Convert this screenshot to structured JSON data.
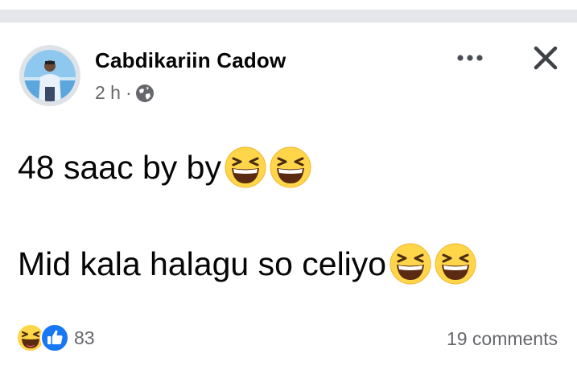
{
  "post": {
    "author_name": "Cabdikariin Cadow",
    "timestamp": "2 h",
    "separator": "·",
    "privacy_icon": "globe-icon",
    "more_icon": "more-options-icon",
    "close_icon": "close-icon",
    "lines": [
      {
        "text": "48 saac by by",
        "emoji": [
          "grinning-squinting-emoji",
          "grinning-squinting-emoji"
        ]
      },
      {
        "text": "Mid kala halagu so celiyo",
        "emoji": [
          "grinning-squinting-emoji",
          "grinning-squinting-emoji"
        ]
      }
    ]
  },
  "footer": {
    "reaction_icons": [
      "haha-reaction-icon",
      "like-reaction-icon"
    ],
    "reaction_count": "83",
    "comments_label": "19 comments"
  },
  "colors": {
    "text_primary": "#050505",
    "text_secondary": "#65676b",
    "like_blue": "#1877f2",
    "emoji_yellow": "#ffd54a",
    "divider_bar": "#e4e6eb"
  }
}
